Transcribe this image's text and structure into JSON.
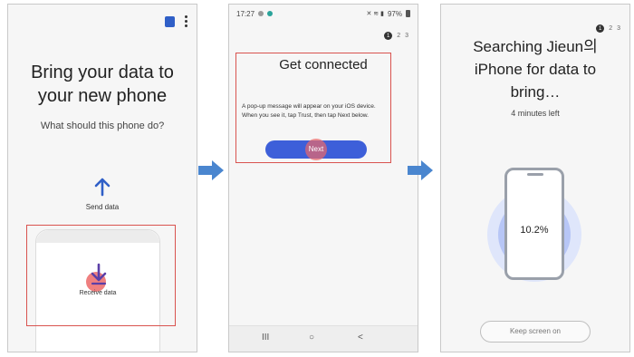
{
  "screen1": {
    "title_line1": "Bring your data to",
    "title_line2": "your new phone",
    "subtitle": "What should this phone do?",
    "send_label": "Send data",
    "receive_label": "Receive data"
  },
  "screen2": {
    "status_time": "17:27",
    "battery": "97%",
    "steps": [
      "1",
      "2",
      "3"
    ],
    "title": "Get connected",
    "message": "A pop-up message will appear on your iOS device. When you see it, tap Trust, then tap Next below.",
    "next_label": "Next",
    "nav_recents": "III",
    "nav_home": "○",
    "nav_back": "<"
  },
  "screen3": {
    "steps": [
      "1",
      "2",
      "3"
    ],
    "title_line1": "Searching Jieun의",
    "title_line2": "iPhone for data to",
    "title_line3": "bring…",
    "subtitle": "4 minutes left",
    "progress_percent": "10.2%",
    "keep_label": "Keep screen on"
  },
  "colors": {
    "accent": "#3d5fd9",
    "highlight_border": "#d9534f",
    "tap_indicator": "#ec6868",
    "arrow": "#4a86cf"
  },
  "icons": [
    "sim-card-icon",
    "more-vert-icon",
    "up-arrow-icon",
    "down-arrow-icon",
    "right-arrow-icon"
  ]
}
